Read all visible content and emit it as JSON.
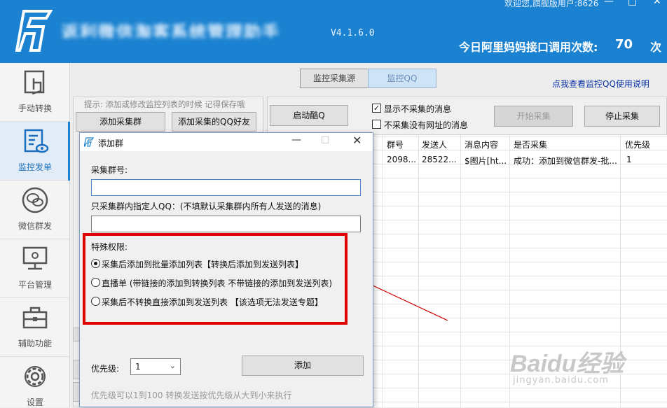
{
  "header": {
    "app_title": "返利微信淘客系统管理助手",
    "version": "V4.1.6.0",
    "welcome": "欢迎您,旗舰版用户:8626",
    "api_label": "今日阿里妈妈接口调用次数:",
    "api_count": "70",
    "api_unit": "次"
  },
  "sidebar": {
    "items": [
      {
        "label": "手动转换",
        "icon": "hand-convert-icon"
      },
      {
        "label": "监控发单",
        "icon": "monitor-send-icon"
      },
      {
        "label": "微信群发",
        "icon": "wechat-icon"
      },
      {
        "label": "平台管理",
        "icon": "platform-icon"
      },
      {
        "label": "辅助功能",
        "icon": "toolbox-icon"
      },
      {
        "label": "设置",
        "icon": "gear-icon"
      }
    ]
  },
  "tabs": [
    {
      "label": "监控采集源"
    },
    {
      "label": "监控QQ"
    }
  ],
  "help_link": "点我查看监控QQ使用说明",
  "left_panel": {
    "hint": "提示: 添加或修改监控列表的时候 记得保存哦",
    "add_group": "添加采集群",
    "add_qq": "添加采集的QQ好友"
  },
  "right_panel": {
    "start_qq": "启动酷Q",
    "show_uncollected": "显示不采集的消息",
    "no_url": "不采集没有网址的消息",
    "start_collect": "开始采集",
    "stop_collect": "停止采集"
  },
  "table": {
    "headers": [
      "群号",
      "发送人",
      "消息内容",
      "是否采集",
      "优先级"
    ],
    "rows": [
      [
        "2098...",
        "28522...",
        "$图片[ht...",
        "成功：添加到微信群发-批...",
        "1"
      ]
    ]
  },
  "dialog": {
    "title": "添加群",
    "group_label": "采集群号:",
    "group_value": "",
    "member_label": "只采集群内指定人QQ：(不填默认采集群内所有人发送的消息)",
    "member_value": "",
    "special_label": "特殊权限:",
    "options": [
      {
        "label": "采集后添加到批量添加列表【转换后添加到发送列表】",
        "checked": true
      },
      {
        "label": "直播单 (带链接的添加到转换列表 不带链接的添加到发送列表)",
        "checked": false
      },
      {
        "label": "采集后不转换直接添加到发送列表 【该选项无法发送专题】",
        "checked": false
      }
    ],
    "priority_label": "优先级:",
    "priority_value": "1",
    "add_button": "添加",
    "priority_note": "优先级可以1到100 转换发送按优先级从大到小来执行"
  },
  "watermark": {
    "main": "Baidu经验",
    "sub": "jingyan.baidu.com"
  },
  "colors": {
    "header_bg": "#1a82d0",
    "highlight_red": "#e00000",
    "link_blue": "#0a32a6"
  }
}
